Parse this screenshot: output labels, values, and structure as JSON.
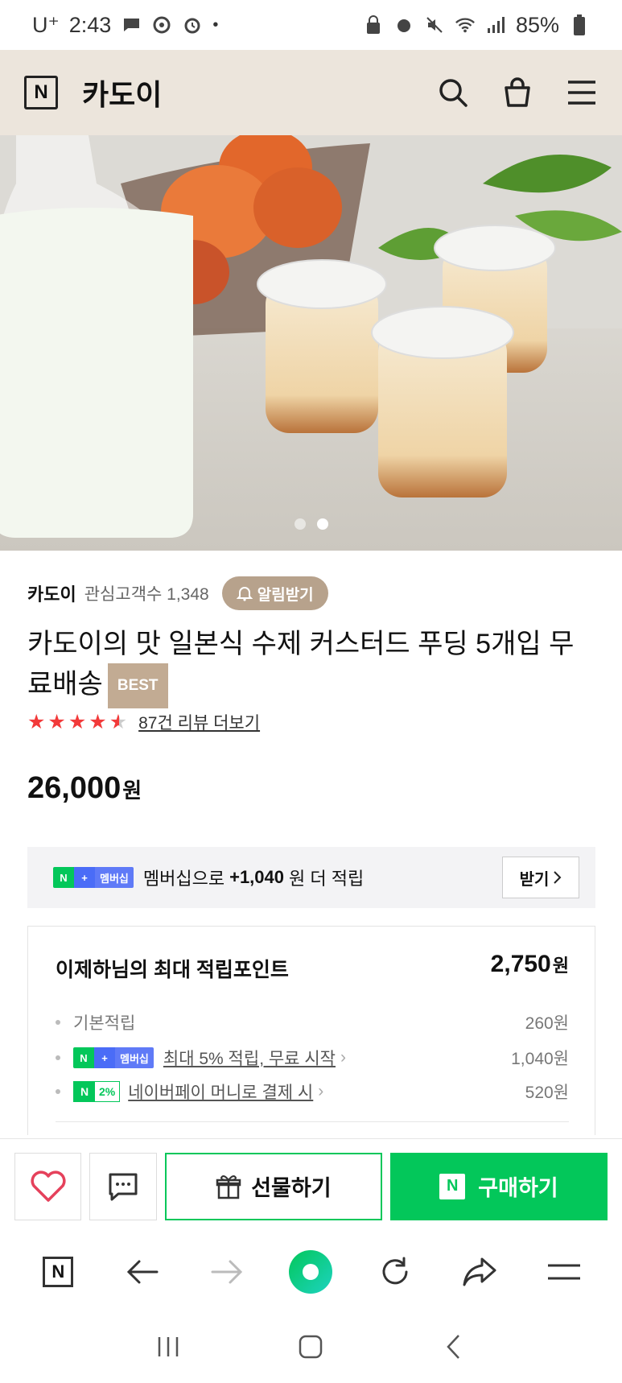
{
  "status_bar": {
    "carrier": "U⁺",
    "time": "2:43",
    "battery": "85%"
  },
  "header": {
    "store_name": "카도이"
  },
  "hero": {
    "slide_count": 2,
    "active_slide": 2
  },
  "product": {
    "seller": "카도이",
    "followers_label": "관심고객수 1,348",
    "notify_label": "알림받기",
    "title": "카도이의 맛 일본식 수제 커스터드 푸딩 5개입 무료배송",
    "best_badge": "BEST",
    "rating_stars": 4.5,
    "review_link": "87건 리뷰 더보기",
    "price": "26,000",
    "price_unit": "원"
  },
  "membership": {
    "badge_n": "N",
    "badge_plus": "+",
    "badge_text": "멤버십",
    "text_before": "멤버십으로",
    "bonus": "+1,040",
    "text_after": "원 더 적립",
    "receive_label": "받기"
  },
  "points": {
    "heading": "이제하님의 최대 적립포인트",
    "total": "2,750",
    "total_unit": "원",
    "rows": [
      {
        "label": "기본적립",
        "amount": "260원"
      },
      {
        "label": "최대 5% 적립, 무료 시작",
        "amount": "1,040원"
      },
      {
        "label": "네이버페이 머니로 결제 시",
        "amount": "520원",
        "badge": "2%"
      }
    ]
  },
  "actions": {
    "gift_label": "선물하기",
    "buy_label": "구매하기",
    "buy_badge": "N"
  },
  "colors": {
    "accent_green": "#03c75a",
    "header_bg": "#ece5dc",
    "star_red": "#f23a3a",
    "tan": "#b7a28c"
  }
}
